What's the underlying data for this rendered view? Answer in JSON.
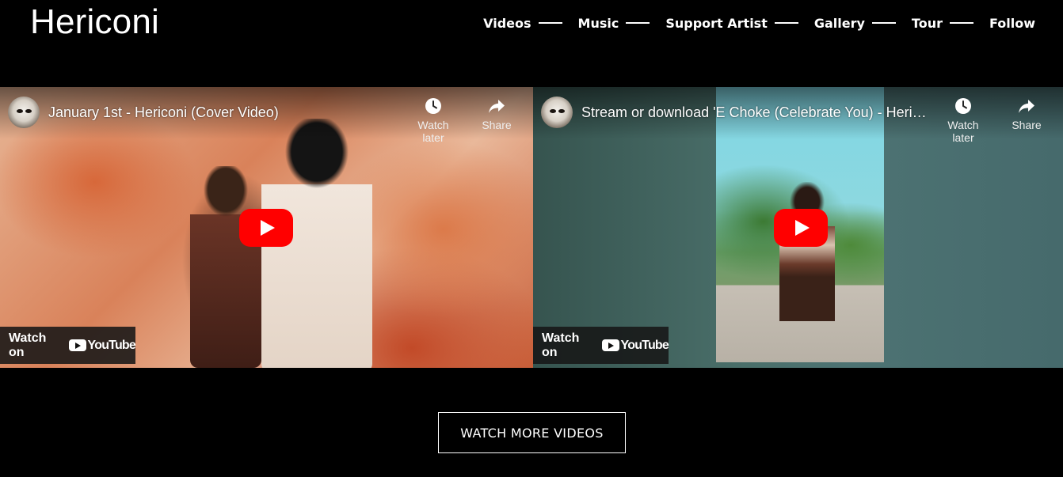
{
  "site": {
    "logo": "Hericoni"
  },
  "nav": {
    "items": [
      {
        "label": "Videos"
      },
      {
        "label": "Music"
      },
      {
        "label": "Support Artist"
      },
      {
        "label": "Gallery"
      },
      {
        "label": "Tour"
      },
      {
        "label": "Follow"
      }
    ]
  },
  "videos": [
    {
      "title": "January 1st - Hericoni (Cover Video)",
      "watch_later_label": "Watch later",
      "share_label": "Share",
      "watch_on_label": "Watch on",
      "platform": "YouTube"
    },
    {
      "title": "Stream or download 'E Choke (Celebrate You) - Hericoni",
      "watch_later_label": "Watch later",
      "share_label": "Share",
      "watch_on_label": "Watch on",
      "platform": "YouTube"
    }
  ],
  "cta": {
    "watch_more_label": "WATCH MORE VIDEOS"
  },
  "colors": {
    "background": "#000000",
    "youtube_red": "#ff0000",
    "text": "#ffffff"
  }
}
